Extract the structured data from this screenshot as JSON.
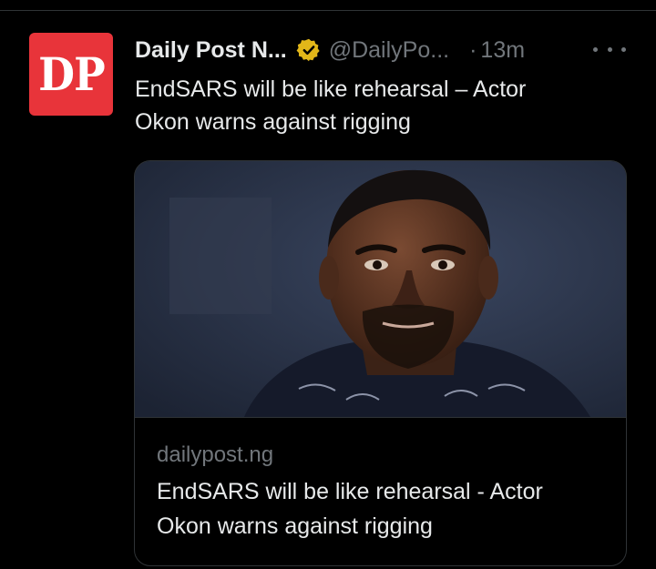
{
  "tweet": {
    "avatar_text": "DP",
    "display_name": "Daily Post N...",
    "verified_icon": "verified-badge-icon",
    "handle": "@DailyPo...",
    "separator": "·",
    "timestamp": "13m",
    "text_line1": "EndSARS will be like rehearsal – Actor",
    "text_line2": "Okon warns against rigging"
  },
  "card": {
    "image_alt": "Photo of actor Okon",
    "domain": "dailypost.ng",
    "title_line1": "EndSARS will be like rehearsal - Actor",
    "title_line2": "Okon warns against rigging"
  },
  "colors": {
    "background": "#000000",
    "text_primary": "#e7e9ea",
    "text_secondary": "#71767b",
    "avatar_bg": "#e8343a",
    "verified_gold": "#e2b719",
    "border": "#2f3336"
  }
}
